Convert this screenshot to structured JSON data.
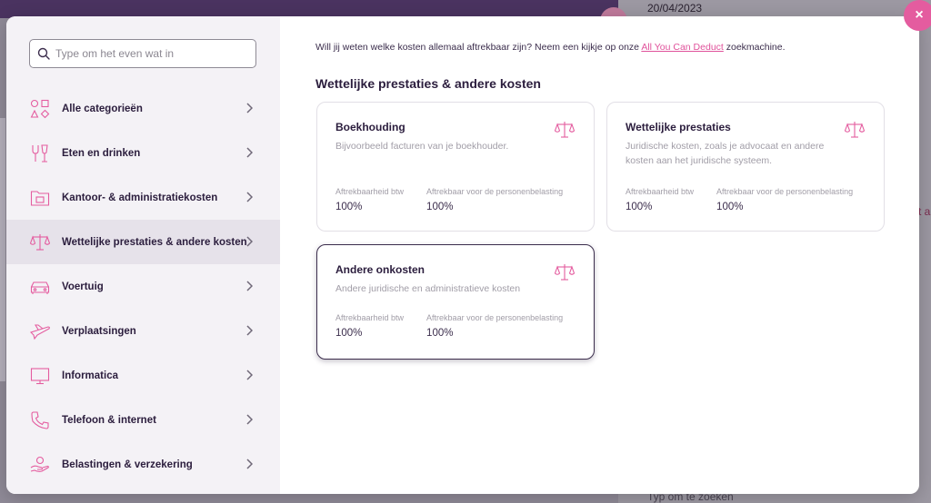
{
  "background": {
    "date": "20/04/2023",
    "search_hint": "Typ om te zoeken",
    "right_letter": "t a"
  },
  "sidebar": {
    "search_placeholder": "Type om het even wat in",
    "items": [
      {
        "label": "Alle categorieën",
        "icon": "shapes-icon"
      },
      {
        "label": "Eten en drinken",
        "icon": "food-drink-icon"
      },
      {
        "label": "Kantoor- & administratiekosten",
        "icon": "folder-icon"
      },
      {
        "label": "Wettelijke prestaties & andere kosten",
        "icon": "scales-icon",
        "active": true
      },
      {
        "label": "Voertuig",
        "icon": "car-icon"
      },
      {
        "label": "Verplaatsingen",
        "icon": "airplane-icon"
      },
      {
        "label": "Informatica",
        "icon": "monitor-icon"
      },
      {
        "label": "Telefoon & internet",
        "icon": "phone-icon"
      },
      {
        "label": "Belastingen & verzekering",
        "icon": "insurance-icon"
      }
    ]
  },
  "main": {
    "intro_before": "Will jij weten welke kosten allemaal aftrekbaar zijn? Neem een kijkje op onze ",
    "intro_link": "All You Can Deduct",
    "intro_after": " zoekmachine.",
    "section_title": "Wettelijke prestaties & andere kosten",
    "cards": [
      {
        "title": "Boekhouding",
        "description": "Bijvoorbeeld facturen van je boekhouder.",
        "stat1_label": "Aftrekbaarheid btw",
        "stat1_value": "100%",
        "stat2_label": "Aftrekbaar voor de personenbelasting",
        "stat2_value": "100%"
      },
      {
        "title": "Wettelijke prestaties",
        "description": "Juridische kosten, zoals je advocaat en andere kosten aan het juridische systeem.",
        "stat1_label": "Aftrekbaarheid btw",
        "stat1_value": "100%",
        "stat2_label": "Aftrekbaar voor de personenbelasting",
        "stat2_value": "100%"
      },
      {
        "title": "Andere onkosten",
        "description": "Andere juridische en administratieve kosten",
        "stat1_label": "Aftrekbaarheid btw",
        "stat1_value": "100%",
        "stat2_label": "Aftrekbaar voor de personenbelasting",
        "stat2_value": "100%",
        "selected": true
      }
    ]
  },
  "close_label": "×",
  "colors": {
    "accent": "#e45c9f",
    "text_dark": "#2b1d3d",
    "sidebar_bg": "#f4f2f6",
    "active_bg": "#e6e2ea"
  }
}
